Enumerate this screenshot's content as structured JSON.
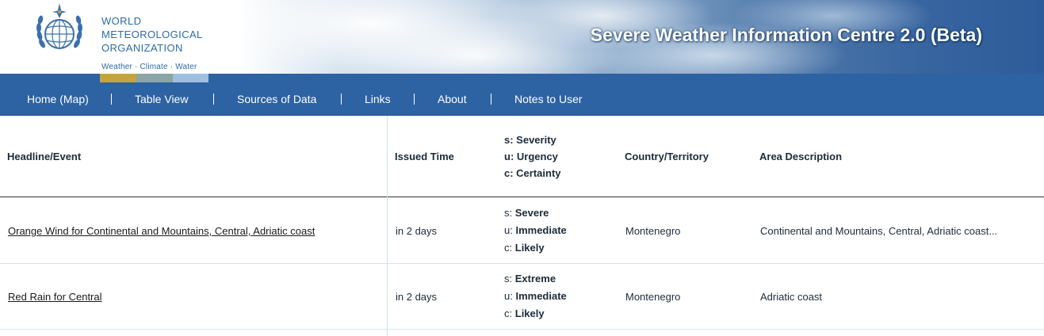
{
  "header": {
    "org_name_lines": [
      "WORLD",
      "METEOROLOGICAL",
      "ORGANIZATION"
    ],
    "tagline": "Weather · Climate · Water",
    "site_title": "Severe Weather Information Centre 2.0 (Beta)"
  },
  "nav": {
    "items": [
      {
        "label": "Home (Map)"
      },
      {
        "label": "Table View"
      },
      {
        "label": "Sources of Data"
      },
      {
        "label": "Links"
      },
      {
        "label": "About"
      },
      {
        "label": "Notes to User"
      }
    ]
  },
  "table": {
    "headers": {
      "headline": "Headline/Event",
      "issued": "Issued Time",
      "suc_lines": [
        "s: Severity",
        "u: Urgency",
        "c: Certainty"
      ],
      "country": "Country/Territory",
      "area": "Area Description"
    },
    "rows": [
      {
        "headline": "Orange Wind for Continental and Mountains, Central, Adriatic coast",
        "issued": "in 2 days",
        "severity_prefix": "s:",
        "severity": "Severe",
        "urgency_prefix": "u:",
        "urgency": "Immediate",
        "certainty_prefix": "c:",
        "certainty": "Likely",
        "country": "Montenegro",
        "area": "Continental and Mountains, Central, Adriatic coast..."
      },
      {
        "headline": "Red Rain for Central",
        "issued": "in 2 days",
        "severity_prefix": "s:",
        "severity": "Extreme",
        "urgency_prefix": "u:",
        "urgency": "Immediate",
        "certainty_prefix": "c:",
        "certainty": "Likely",
        "country": "Montenegro",
        "area": "Adriatic coast"
      }
    ]
  },
  "colors": {
    "nav_blue": "#2d62a3",
    "org_text": "#2d6aa8",
    "strip_gold": "#c3a53c",
    "strip_teal": "#8aa6a6",
    "strip_light_blue": "#9fbfe0"
  }
}
